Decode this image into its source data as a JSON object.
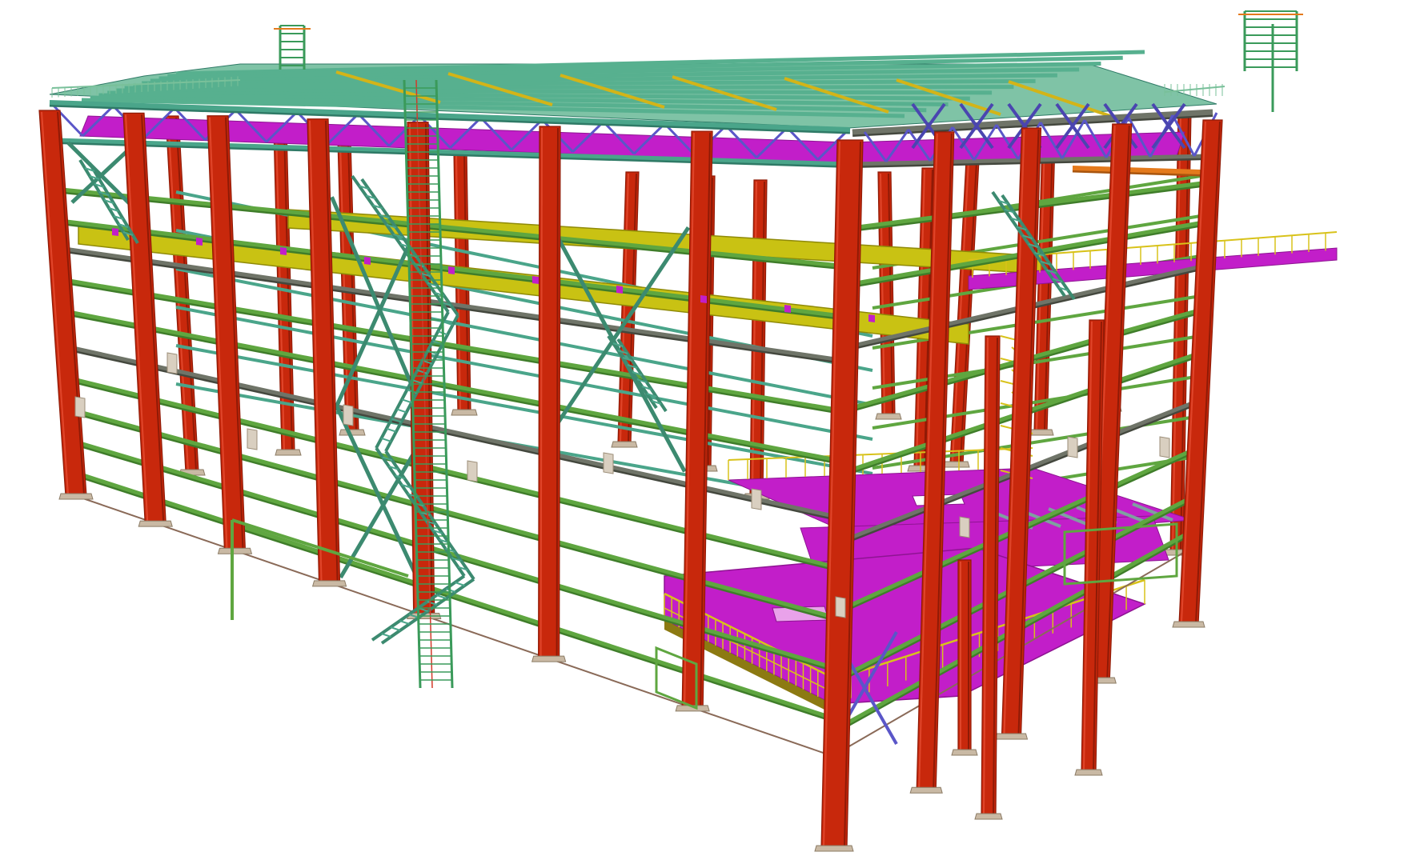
{
  "model": {
    "colors": {
      "background": "#ffffff",
      "column": "#c8280c",
      "column_edge": "#8f1a06",
      "column_light": "#e0452a",
      "girt": "#5fa640",
      "girt_dark": "#3f7d2a",
      "strut": "#4aa58a",
      "strut_dark": "#2f7a66",
      "bracing": "#3c8a70",
      "truss": "#5a56c8",
      "crane_beam": "#c9c213",
      "crane_beam_dark": "#8f8a08",
      "deck": "#c21ec9",
      "deck_dark": "#8e1492",
      "handrail": "#d8c21a",
      "roof_purlin": "#57b08f",
      "roof_beam": "#d3b418",
      "grey_beam": "#6f7468",
      "base_plate": "#c9b9a4",
      "ladder": "#3a9a5a",
      "orange": "#e47a1c"
    },
    "icons": {
      "stair": "stair-icon",
      "ladder": "ladder-icon",
      "column": "steel-column-icon"
    }
  }
}
